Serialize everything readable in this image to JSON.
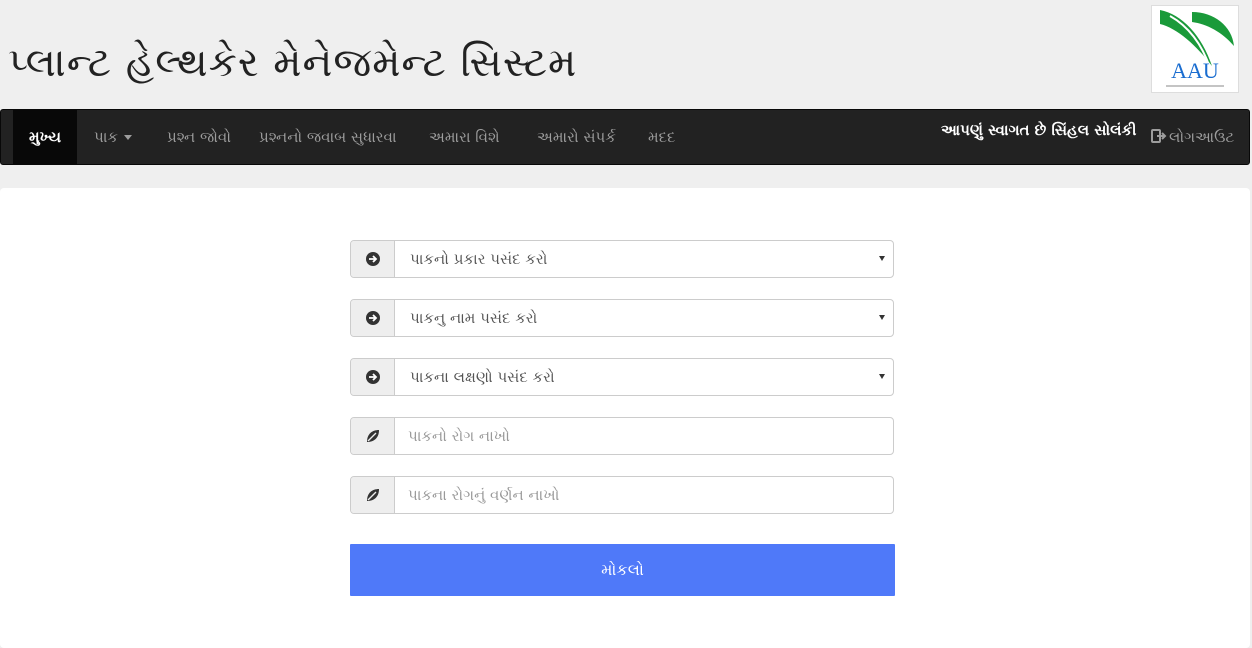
{
  "header": {
    "title": "પ્લાન્ટ હેલ્થકેર મેનેજમેન્ટ સિસ્ટમ",
    "logo_text": "AAU"
  },
  "nav": {
    "items": [
      {
        "label": "મુખ્ય"
      },
      {
        "label": "પાક"
      },
      {
        "label": "પ્રશ્ન જોવો"
      },
      {
        "label": "પ્રશ્નનો જવાબ સુધારવા"
      },
      {
        "label": "અમારા વિશે"
      },
      {
        "label": "અમારો સંપર્ક"
      },
      {
        "label": "મદદ"
      }
    ],
    "welcome": "આપણું સ્વાગત છે સિંહલ સોલંકી",
    "logout": "લોગઆઉટ"
  },
  "form": {
    "crop_type": {
      "value": "પાકનો પ્રકાર પસંદ કરો"
    },
    "crop_name": {
      "value": "પાકનુ નામ પસંદ કરો"
    },
    "crop_symptoms": {
      "value": "પાકના લક્ષણો પસંદ કરો"
    },
    "disease": {
      "placeholder": "પાકનો રોગ નાખો"
    },
    "disease_desc": {
      "placeholder": "પાકના રોગનું વર્ણન નાખો"
    },
    "submit_label": "મોકલો"
  },
  "colors": {
    "navbar_bg": "#222222",
    "submit_bg": "#4f79f9",
    "logo_green": "#1a9a3a"
  }
}
